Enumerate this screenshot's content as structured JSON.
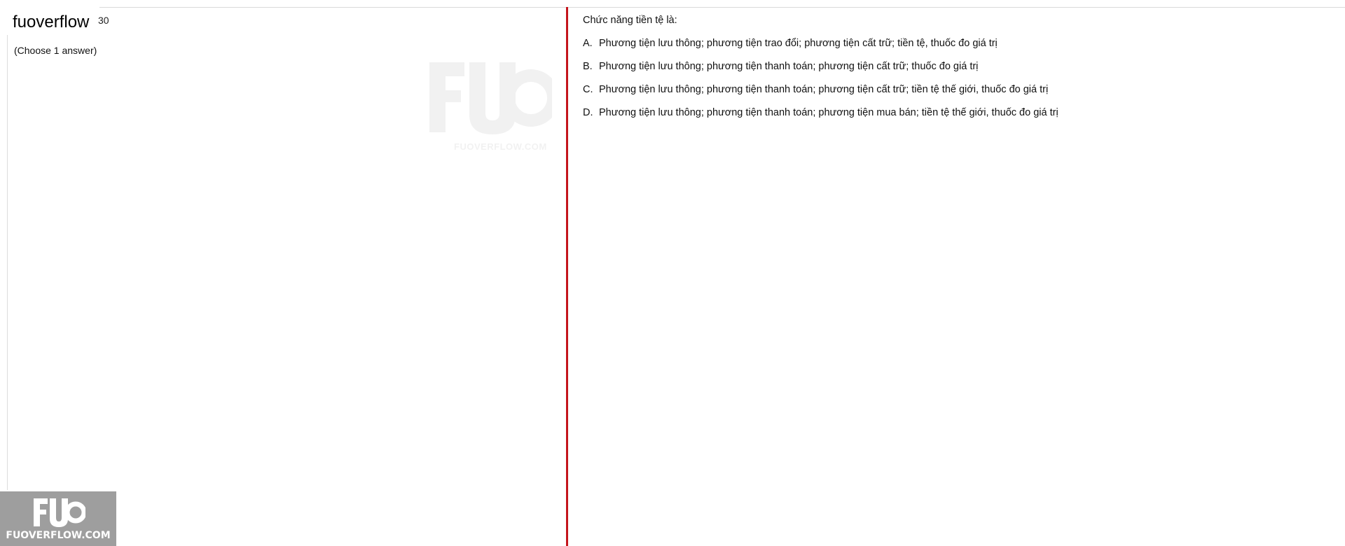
{
  "header": {
    "brand": "fuoverflow",
    "question_number_fragment": "30"
  },
  "question_panel": {
    "instruction": "(Choose 1 answer)",
    "question": "Chức năng tiền tệ là:",
    "options": [
      {
        "letter": "A.",
        "text": "Phương tiện lưu thông; phương tiện trao đổi; phương tiện cất trữ; tiền tệ, thuốc đo giá trị"
      },
      {
        "letter": "B.",
        "text": "Phương tiện lưu thông; phương tiện thanh toán; phương tiện cất trữ; thuốc đo giá trị"
      },
      {
        "letter": "C.",
        "text": "Phương tiện lưu thông; phương tiện thanh toán; phương tiện cất trữ; tiền tệ thế giới, thuốc đo giá trị"
      },
      {
        "letter": "D.",
        "text": "Phương tiện lưu thông; phương tiện thanh toán; phương tiện mua bán; tiền tệ thế giới, thuốc đo giá trị"
      }
    ]
  },
  "watermark": {
    "logo_letters": "FUO",
    "site": "FUOVERFLOW.COM"
  },
  "colors": {
    "divider": "#c4141c",
    "logo_bg": "#9e9e9e"
  }
}
